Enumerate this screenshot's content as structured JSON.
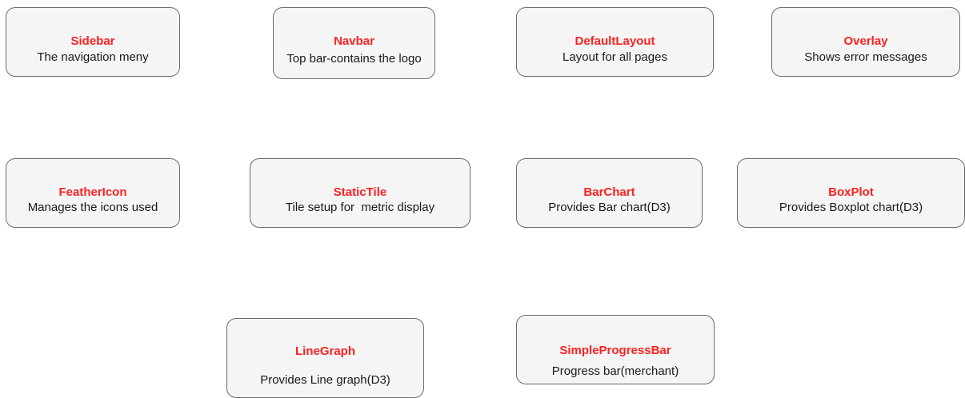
{
  "boxes": {
    "sidebar": {
      "title": "Sidebar",
      "desc": "The navigation meny"
    },
    "navbar": {
      "title": "Navbar",
      "desc": "Top bar-contains the logo"
    },
    "default_layout": {
      "title": "DefaultLayout",
      "desc": "Layout for all pages"
    },
    "overlay": {
      "title": "Overlay",
      "desc": "Shows error messages"
    },
    "feather_icon": {
      "title": "FeatherIcon",
      "desc": "Manages the icons used"
    },
    "static_tile": {
      "title": "StaticTile",
      "desc": "Tile setup for  metric display"
    },
    "bar_chart": {
      "title": "BarChart",
      "desc": "Provides Bar chart(D3)"
    },
    "box_plot": {
      "title": "BoxPlot",
      "desc": "Provides Boxplot chart(D3)"
    },
    "line_graph": {
      "title": "LineGraph",
      "desc": "Provides Line graph(D3)"
    },
    "simple_progress_bar": {
      "title": "SimpleProgressBar",
      "desc": "Progress bar(merchant)"
    }
  },
  "colors": {
    "title_text": "#ff2020",
    "box_fill": "#f5f5f5",
    "box_border": "#6b6b6b",
    "desc_text": "#1a1a1a"
  }
}
